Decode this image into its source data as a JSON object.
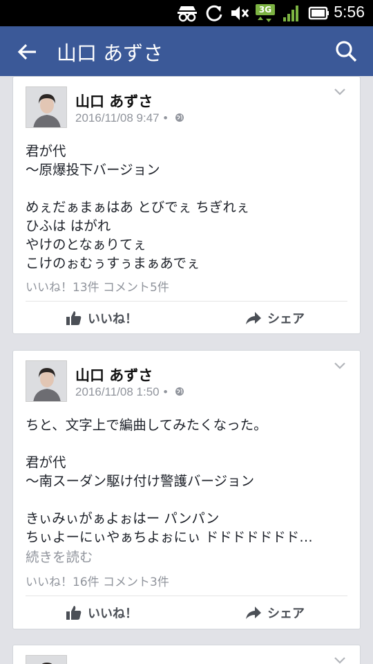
{
  "status_bar": {
    "network": "3G",
    "time": "5:56"
  },
  "app_bar": {
    "title": "山口 あずさ"
  },
  "posts": [
    {
      "author": "山口 あずさ",
      "timestamp": "2016/11/08 9:47",
      "privacy_icon": "globe-icon",
      "text": "君が代\n〜原爆投下バージョン\n\nめぇだぁまぁはあ とびでぇ ちぎれぇ\nひふは はがれ\nやけのとなぁりてぇ\nこけのぉむぅすぅまぁあでぇ",
      "stats": "いいね！13件  コメント5件",
      "like_label": "いいね！",
      "share_label": "シェア"
    },
    {
      "author": "山口 あずさ",
      "timestamp": "2016/11/08 1:50",
      "privacy_icon": "globe-icon",
      "text": "ちと、文字上で編曲してみたくなった。\n\n君が代\n〜南スーダン駆け付け警護バージョン\n\nきぃみぃがぁよぉはー パンパン\nちぃよーにぃやぁちよぉにぃ ドドドドドドド…",
      "see_more": "続きを読む",
      "stats": "いいね！16件  コメント3件",
      "like_label": "いいね！",
      "share_label": "シェア"
    }
  ]
}
